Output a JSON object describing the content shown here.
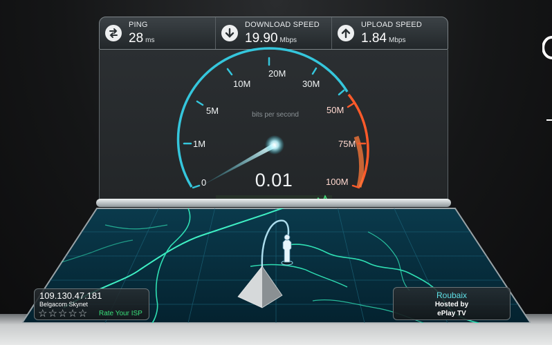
{
  "stats": {
    "ping": {
      "label": "PING",
      "value": "28",
      "unit": "ms",
      "icon": "ping-arrows-icon"
    },
    "download": {
      "label": "DOWNLOAD SPEED",
      "value": "19.90",
      "unit": "Mbps",
      "icon": "download-arrow-icon"
    },
    "upload": {
      "label": "UPLOAD SPEED",
      "value": "1.84",
      "unit": "Mbps",
      "icon": "upload-arrow-icon"
    }
  },
  "gauge": {
    "subtitle": "bits per second",
    "current": "0.01",
    "ticks": [
      "0",
      "1M",
      "5M",
      "10M",
      "20M",
      "30M",
      "50M",
      "75M",
      "100M"
    ],
    "needle_fraction": 0.0,
    "arc_color": "#35c6dc",
    "high_arc_color": "#ff5a2a"
  },
  "client": {
    "ip": "109.130.47.181",
    "isp": "Belgacom Skynet",
    "rating_stars": 5,
    "rate_label": "Rate Your ISP"
  },
  "server": {
    "city": "Roubaix",
    "hosted_by": "Hosted by",
    "host": "ePlay TV"
  },
  "colors": {
    "accent": "#35c6dc",
    "map_lines": "#2fe0b4",
    "rate_link": "#39e07a"
  }
}
